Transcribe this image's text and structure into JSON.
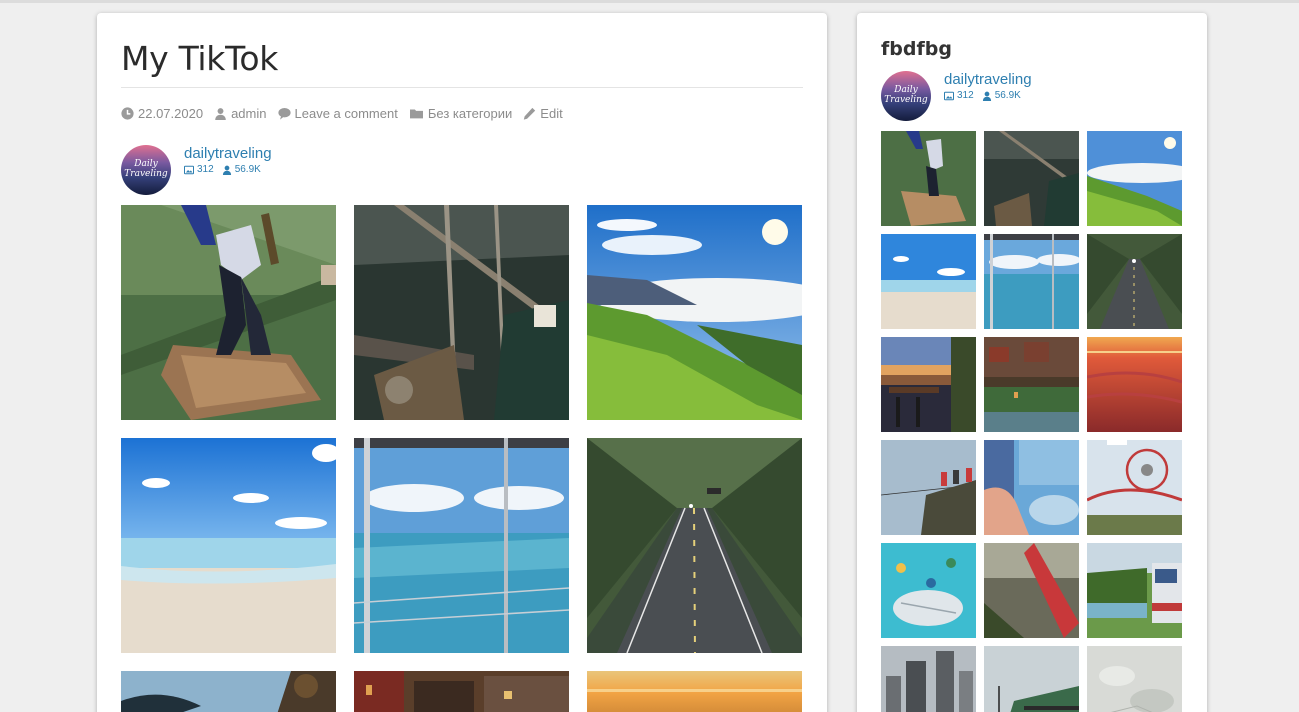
{
  "post": {
    "title": "My TikTok",
    "meta": {
      "date": "22.07.2020",
      "author": "admin",
      "comments": "Leave a comment",
      "category": "Без категории",
      "edit": "Edit"
    }
  },
  "feed": {
    "username": "dailytraveling",
    "avatar_text": "Daily Traveling",
    "posts_count": "312",
    "followers": "56.9K"
  },
  "main_tiles": [
    "cliff-plank-walk",
    "ship-rigging",
    "mountain-sea-of-clouds",
    "blue-sky-beach",
    "ocean-view-balcony",
    "tree-lined-road",
    "sunset-silhouette",
    "old-town-street",
    "orange-horizon-sunset"
  ],
  "sidebar": {
    "widget_title": "fbdfbg",
    "tiles": [
      "cliff-plank-walk",
      "ship-rigging",
      "mountain-sea-of-clouds",
      "blue-sky-beach",
      "ocean-view-balcony",
      "tree-lined-road",
      "rooftop-terrace-night",
      "village-canal",
      "red-sea-sunset",
      "cliff-zipline",
      "misty-waterfall-hand",
      "ferris-wheel-rollercoaster",
      "sky-observation-deck",
      "red-rollercoaster",
      "riverside-campervan",
      "city-skyscrapers",
      "foggy-glass-walkway",
      "frozen-ice-surface"
    ]
  },
  "colors": {
    "link": "#2e7fb0",
    "meta_text": "#8c8c8c",
    "page_background": "#efefef"
  }
}
